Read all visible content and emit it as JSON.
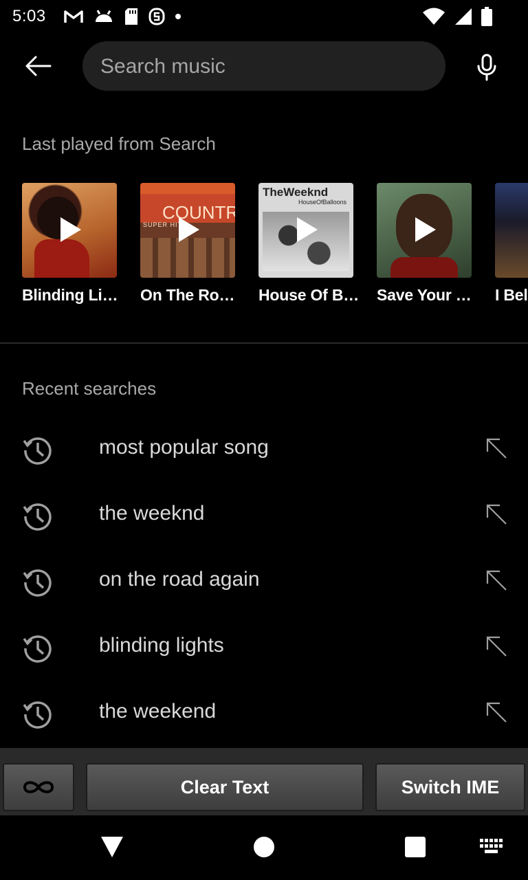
{
  "status_bar": {
    "time": "5:03",
    "left_icons": [
      "gmail-icon",
      "android-icon",
      "sd-card-icon",
      "app-s-icon",
      "dot-icon"
    ],
    "right_icons": [
      "wifi-icon",
      "signal-icon",
      "battery-icon"
    ]
  },
  "search": {
    "placeholder": "Search music",
    "value": ""
  },
  "last_played": {
    "title": "Last played from Search",
    "items": [
      {
        "title": "Blinding Li…"
      },
      {
        "title": "On The Ro…"
      },
      {
        "title": "House Of B…"
      },
      {
        "title": "Save Your …"
      },
      {
        "title": "I Bel"
      }
    ]
  },
  "art": {
    "country_label": "COUNTRY",
    "country_sub": "SUPER HITS",
    "weeknd_label": "TheWeeknd",
    "weeknd_sub": "HouseOfBalloons"
  },
  "recent_searches": {
    "title": "Recent searches",
    "items": [
      {
        "text": "most popular song"
      },
      {
        "text": "the weeknd"
      },
      {
        "text": "on the road again"
      },
      {
        "text": "blinding lights"
      },
      {
        "text": "the weekend"
      }
    ]
  },
  "ime": {
    "clear_label": "Clear Text",
    "switch_label": "Switch IME"
  },
  "colors": {
    "background": "#000000",
    "search_box": "#212121",
    "secondary_text": "#a9a9a9"
  }
}
